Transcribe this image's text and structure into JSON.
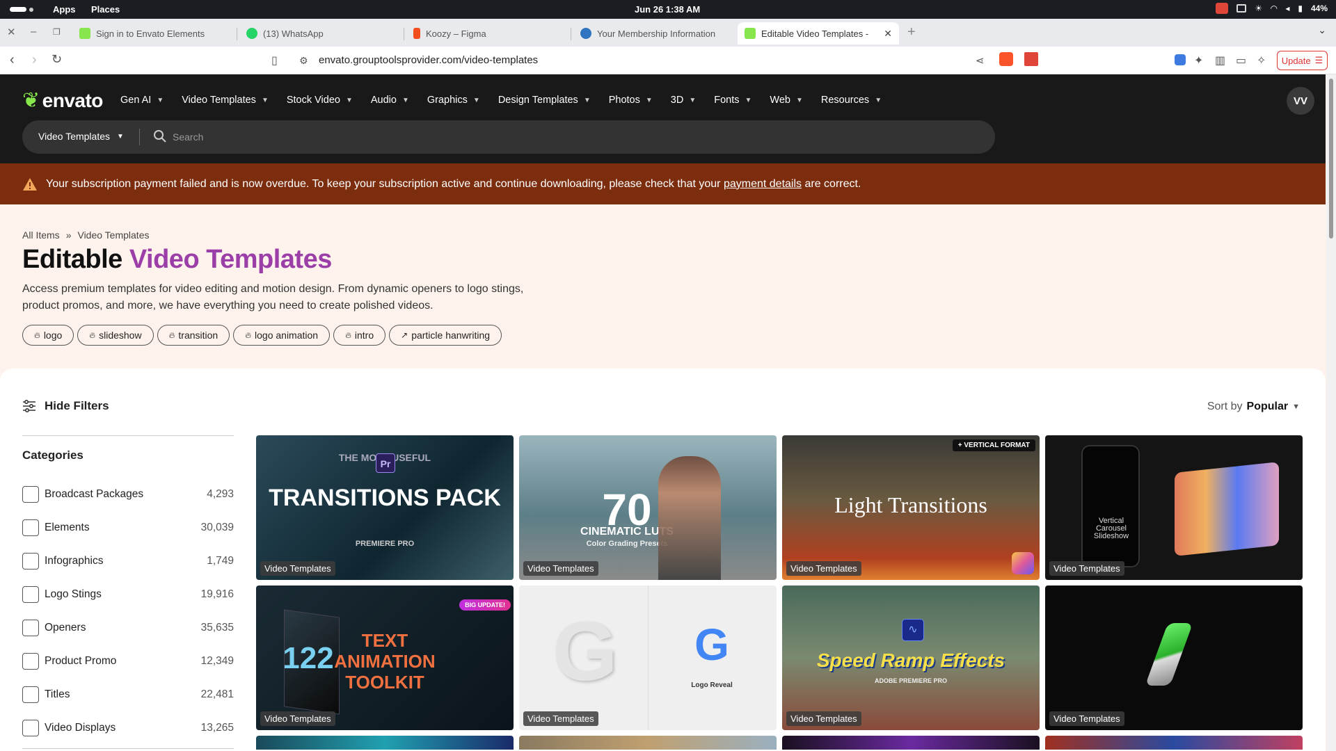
{
  "os": {
    "apps": "Apps",
    "places": "Places",
    "clock": "Jun 26  1:38 AM",
    "battery": "44%"
  },
  "tabs": [
    {
      "title": "Sign in to Envato Elements",
      "color": "#87e64b"
    },
    {
      "title": "(13) WhatsApp",
      "color": "#25d366"
    },
    {
      "title": "Koozy – Figma",
      "color": "#f24e1e"
    },
    {
      "title": "Your Membership Information",
      "color": "#2f74c0"
    },
    {
      "title": "Editable Video Templates -",
      "color": "#87e64b"
    }
  ],
  "address": {
    "url": "envato.grouptoolsprovider.com/video-templates",
    "update_label": "Update"
  },
  "header": {
    "logo": "envato",
    "nav": [
      "Gen AI",
      "Video Templates",
      "Stock Video",
      "Audio",
      "Graphics",
      "Design Templates",
      "Photos",
      "3D",
      "Fonts",
      "Web",
      "Resources"
    ],
    "avatar": "VV",
    "search_category": "Video Templates",
    "search_placeholder": "Search"
  },
  "alert": {
    "text_before": "Your subscription payment failed and is now overdue. To keep your subscription active and continue downloading, please check that your",
    "link": "payment details",
    "text_after": "are correct."
  },
  "hero": {
    "breadcrumb": [
      "All Items",
      "»",
      "Video Templates"
    ],
    "title_plain": "Editable",
    "title_accent": "Video Templates",
    "description": "Access premium templates for video editing and motion design. From dynamic openers to logo stings, product promos, and more, we have everything you need to create polished videos.",
    "chips": [
      {
        "icon": "flame",
        "label": "logo"
      },
      {
        "icon": "flame",
        "label": "slideshow"
      },
      {
        "icon": "flame",
        "label": "transition"
      },
      {
        "icon": "flame",
        "label": "logo animation"
      },
      {
        "icon": "flame",
        "label": "intro"
      },
      {
        "icon": "trend",
        "label": "particle hanwriting"
      }
    ]
  },
  "filters": {
    "hide_label": "Hide Filters",
    "sort_prefix": "Sort by",
    "sort_value": "Popular",
    "categories_title": "Categories",
    "categories": [
      {
        "name": "Broadcast Packages",
        "count": "4,293"
      },
      {
        "name": "Elements",
        "count": "30,039"
      },
      {
        "name": "Infographics",
        "count": "1,749"
      },
      {
        "name": "Logo Stings",
        "count": "19,916"
      },
      {
        "name": "Openers",
        "count": "35,635"
      },
      {
        "name": "Product Promo",
        "count": "12,349"
      },
      {
        "name": "Titles",
        "count": "22,481"
      },
      {
        "name": "Video Displays",
        "count": "13,265"
      }
    ]
  },
  "cards": [
    {
      "badge": "Video Templates",
      "headline": "TRANSITIONS PACK",
      "sub": "PREMIERE PRO",
      "top_label": "THE MOST USEFUL",
      "bg": "#1e3a4a"
    },
    {
      "badge": "Video Templates",
      "headline": "70",
      "sub": "CINEMATIC LUTS",
      "top_label": "Color Grading Presets",
      "bg": "#6f8e9a"
    },
    {
      "badge": "Video Templates",
      "headline": "Light Transitions",
      "sub": "",
      "top_label": "+ VERTICAL FORMAT",
      "bg": "#4a3a2a"
    },
    {
      "badge": "Video Templates",
      "headline": "Vertical Carousel Slideshow",
      "sub": "",
      "top_label": "",
      "bg": "#151515"
    },
    {
      "badge": "Video Templates",
      "headline": "TEXT ANIMATION TOOLKIT",
      "sub": "122",
      "top_label": "BIG UPDATE!",
      "bg": "#0e1a22"
    },
    {
      "badge": "Video Templates",
      "headline": "G",
      "sub": "Logo Reveal",
      "top_label": "",
      "bg": "#eeeeee"
    },
    {
      "badge": "Video Templates",
      "headline": "Speed Ramp Effects",
      "sub": "ADOBE PREMIERE PRO",
      "top_label": "",
      "bg": "#5a7a6a"
    },
    {
      "badge": "Video Templates",
      "headline": "",
      "sub": "",
      "top_label": "",
      "bg": "#0a0a0a"
    }
  ]
}
